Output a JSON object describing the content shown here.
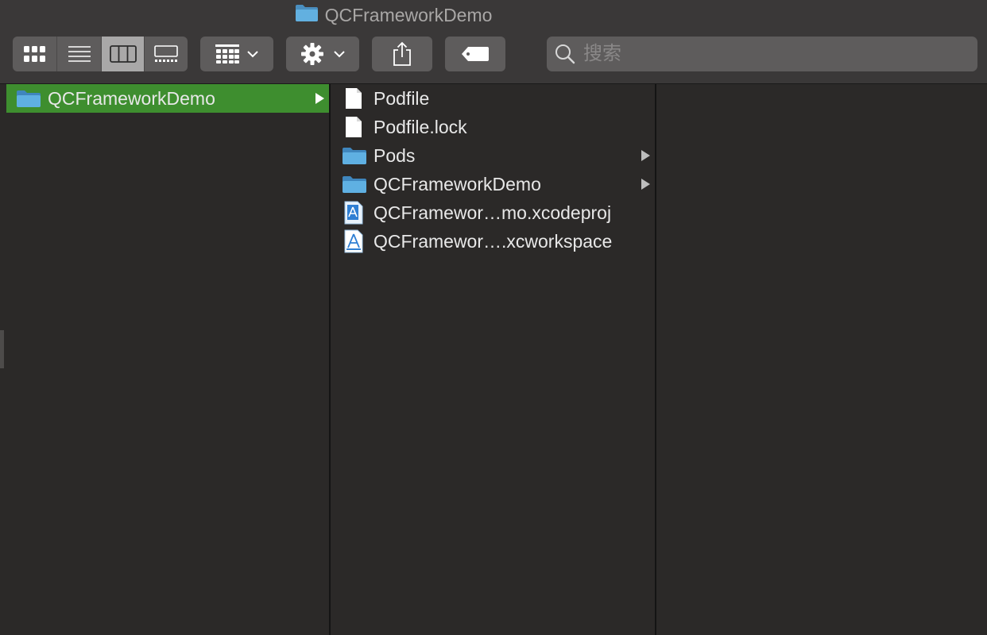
{
  "window": {
    "title": "QCFrameworkDemo",
    "title_icon": "folder-icon"
  },
  "toolbar": {
    "view_modes": [
      {
        "icon": "icon-view-icon",
        "active": false
      },
      {
        "icon": "list-view-icon",
        "active": false
      },
      {
        "icon": "column-view-icon",
        "active": true
      },
      {
        "icon": "gallery-view-icon",
        "active": false
      }
    ],
    "group_icon": "group-by-icon",
    "action_icon": "gear-icon",
    "share_icon": "share-icon",
    "tag_icon": "tag-icon",
    "search_placeholder": "搜索"
  },
  "columns": {
    "col1": [
      {
        "name": "QCFrameworkDemo",
        "icon": "folder-icon",
        "selected": true,
        "has_children": true
      }
    ],
    "col2": [
      {
        "name": "Podfile",
        "icon": "document-icon",
        "has_children": false
      },
      {
        "name": "Podfile.lock",
        "icon": "document-icon",
        "has_children": false
      },
      {
        "name": "Pods",
        "icon": "folder-icon",
        "has_children": true
      },
      {
        "name": "QCFrameworkDemo",
        "icon": "folder-icon",
        "has_children": true
      },
      {
        "name": "QCFramewor…mo.xcodeproj",
        "icon": "xcode-project-icon",
        "has_children": false
      },
      {
        "name": "QCFramewor….xcworkspace",
        "icon": "xcode-workspace-icon",
        "has_children": false
      }
    ],
    "col3": []
  },
  "colors": {
    "selection": "#3e8e2f",
    "folder": "#5aa9dd",
    "background": "#2b2928",
    "toolbar": "#3a3838"
  }
}
